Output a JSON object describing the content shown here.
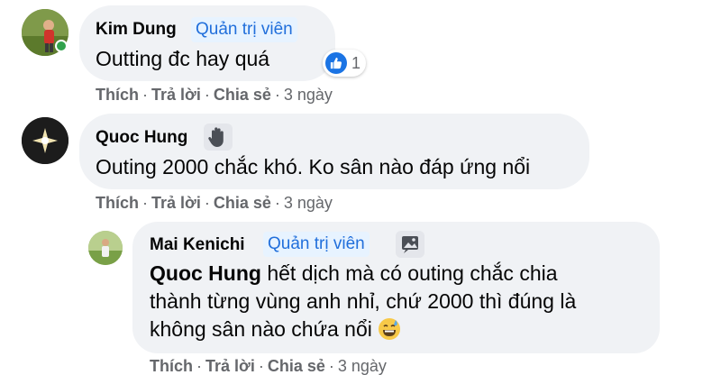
{
  "comments": [
    {
      "author": "Kim Dung",
      "badge": "Quản trị viên",
      "text": "Outting đc hay quá",
      "reaction_count": "1",
      "actions": {
        "like": "Thích",
        "reply": "Trả lời",
        "share": "Chia sẻ",
        "time": "3 ngày"
      }
    },
    {
      "author": "Quoc Hung",
      "text": "Outing 2000 chắc khó. Ko sân nào đáp ứng nổi",
      "actions": {
        "like": "Thích",
        "reply": "Trả lời",
        "share": "Chia sẻ",
        "time": "3 ngày"
      }
    }
  ],
  "reply": {
    "author": "Mai Kenichi",
    "badge": "Quản trị viên",
    "mention": "Quoc Hung",
    "text_line1": " hết dịch mà có outing chắc chia",
    "text_line2": "thành từng vùng anh nhỉ, chứ 2000 thì đúng là",
    "text_line3": "không sân nào chứa nổi",
    "actions": {
      "like": "Thích",
      "reply": "Trả lời",
      "share": "Chia sẻ",
      "time": "3 ngày"
    }
  },
  "colors": {
    "bubble": "#f0f2f5",
    "badge_bg": "#e7f3ff",
    "badge_text": "#216fdb",
    "meta": "#65676b",
    "like_blue": "#1b74e4",
    "online": "#31a24c"
  }
}
